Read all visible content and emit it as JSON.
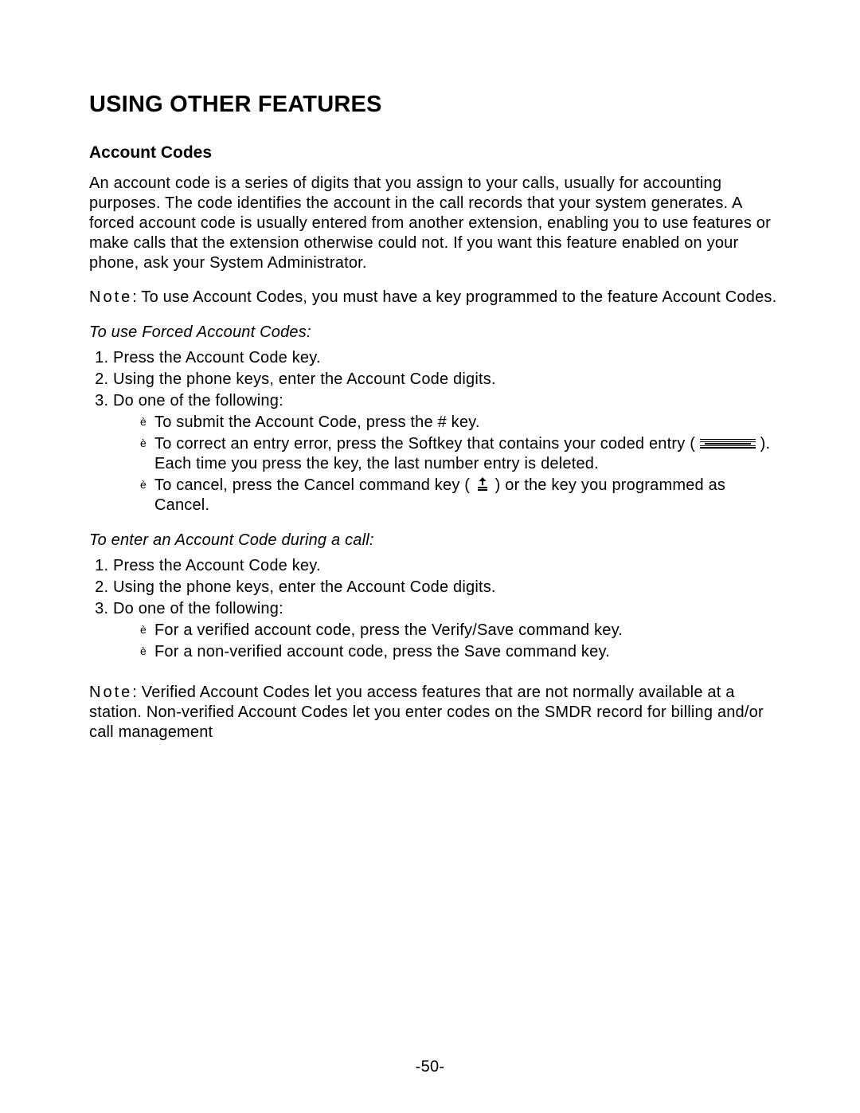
{
  "h1": "USING OTHER FEATURES",
  "section": {
    "title": "Account Codes",
    "intro": "An account code is a series of digits that you assign to your calls, usually for accounting purposes. The code identifies the account in the call records that your system generates. A forced account code is usually entered from another extension, enabling you to use features or make calls that the extension otherwise could not. If you want this feature enabled on your phone, ask your System Administrator.",
    "note1_label": "Note",
    "note1_text": ": To use Account Codes, you must have a key programmed to the feature Account Codes.",
    "sub1": "To use Forced Account Codes:",
    "steps1": {
      "s1": "Press the Account Code key.",
      "s2": "Using the phone keys, enter the Account Code digits.",
      "s3": "Do one of the following:",
      "b1": "To submit the Account Code, press the # key.",
      "b2a": "To correct an entry error, press the Softkey that contains your coded entry ( ",
      "b2b": " ). Each time you press the key, the last number entry is deleted.",
      "b3a": "To cancel, press the Cancel command key ( ",
      "b3b": " ) or the key you programmed as Cancel."
    },
    "sub2": "To enter an Account Code during a call:",
    "steps2": {
      "s1": "Press the Account Code key.",
      "s2": "Using the phone keys, enter the Account Code digits.",
      "s3": "Do one of the following:",
      "b1": "For a verified account code, press the Verify/Save command key.",
      "b2": "For a non-verified account code, press the Save command key."
    },
    "note2_label": "Note",
    "note2_text": ": Verified Account Codes let you access features that are not normally available at a station. Non-verified Account Codes let you enter codes on the SMDR record for billing and/or call management"
  },
  "page_number": "-50-"
}
